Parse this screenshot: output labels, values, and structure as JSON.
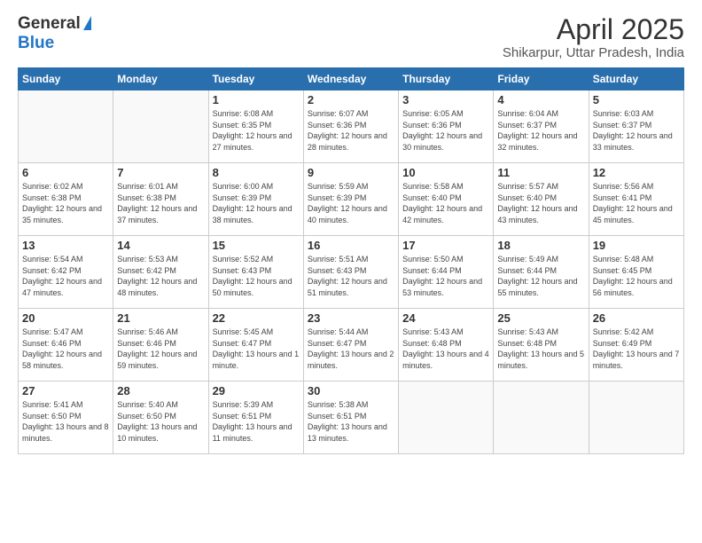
{
  "logo": {
    "line1": "General",
    "line2": "Blue"
  },
  "title": "April 2025",
  "subtitle": "Shikarpur, Uttar Pradesh, India",
  "days_of_week": [
    "Sunday",
    "Monday",
    "Tuesday",
    "Wednesday",
    "Thursday",
    "Friday",
    "Saturday"
  ],
  "weeks": [
    [
      {
        "day": "",
        "info": ""
      },
      {
        "day": "",
        "info": ""
      },
      {
        "day": "1",
        "info": "Sunrise: 6:08 AM\nSunset: 6:35 PM\nDaylight: 12 hours and 27 minutes."
      },
      {
        "day": "2",
        "info": "Sunrise: 6:07 AM\nSunset: 6:36 PM\nDaylight: 12 hours and 28 minutes."
      },
      {
        "day": "3",
        "info": "Sunrise: 6:05 AM\nSunset: 6:36 PM\nDaylight: 12 hours and 30 minutes."
      },
      {
        "day": "4",
        "info": "Sunrise: 6:04 AM\nSunset: 6:37 PM\nDaylight: 12 hours and 32 minutes."
      },
      {
        "day": "5",
        "info": "Sunrise: 6:03 AM\nSunset: 6:37 PM\nDaylight: 12 hours and 33 minutes."
      }
    ],
    [
      {
        "day": "6",
        "info": "Sunrise: 6:02 AM\nSunset: 6:38 PM\nDaylight: 12 hours and 35 minutes."
      },
      {
        "day": "7",
        "info": "Sunrise: 6:01 AM\nSunset: 6:38 PM\nDaylight: 12 hours and 37 minutes."
      },
      {
        "day": "8",
        "info": "Sunrise: 6:00 AM\nSunset: 6:39 PM\nDaylight: 12 hours and 38 minutes."
      },
      {
        "day": "9",
        "info": "Sunrise: 5:59 AM\nSunset: 6:39 PM\nDaylight: 12 hours and 40 minutes."
      },
      {
        "day": "10",
        "info": "Sunrise: 5:58 AM\nSunset: 6:40 PM\nDaylight: 12 hours and 42 minutes."
      },
      {
        "day": "11",
        "info": "Sunrise: 5:57 AM\nSunset: 6:40 PM\nDaylight: 12 hours and 43 minutes."
      },
      {
        "day": "12",
        "info": "Sunrise: 5:56 AM\nSunset: 6:41 PM\nDaylight: 12 hours and 45 minutes."
      }
    ],
    [
      {
        "day": "13",
        "info": "Sunrise: 5:54 AM\nSunset: 6:42 PM\nDaylight: 12 hours and 47 minutes."
      },
      {
        "day": "14",
        "info": "Sunrise: 5:53 AM\nSunset: 6:42 PM\nDaylight: 12 hours and 48 minutes."
      },
      {
        "day": "15",
        "info": "Sunrise: 5:52 AM\nSunset: 6:43 PM\nDaylight: 12 hours and 50 minutes."
      },
      {
        "day": "16",
        "info": "Sunrise: 5:51 AM\nSunset: 6:43 PM\nDaylight: 12 hours and 51 minutes."
      },
      {
        "day": "17",
        "info": "Sunrise: 5:50 AM\nSunset: 6:44 PM\nDaylight: 12 hours and 53 minutes."
      },
      {
        "day": "18",
        "info": "Sunrise: 5:49 AM\nSunset: 6:44 PM\nDaylight: 12 hours and 55 minutes."
      },
      {
        "day": "19",
        "info": "Sunrise: 5:48 AM\nSunset: 6:45 PM\nDaylight: 12 hours and 56 minutes."
      }
    ],
    [
      {
        "day": "20",
        "info": "Sunrise: 5:47 AM\nSunset: 6:46 PM\nDaylight: 12 hours and 58 minutes."
      },
      {
        "day": "21",
        "info": "Sunrise: 5:46 AM\nSunset: 6:46 PM\nDaylight: 12 hours and 59 minutes."
      },
      {
        "day": "22",
        "info": "Sunrise: 5:45 AM\nSunset: 6:47 PM\nDaylight: 13 hours and 1 minute."
      },
      {
        "day": "23",
        "info": "Sunrise: 5:44 AM\nSunset: 6:47 PM\nDaylight: 13 hours and 2 minutes."
      },
      {
        "day": "24",
        "info": "Sunrise: 5:43 AM\nSunset: 6:48 PM\nDaylight: 13 hours and 4 minutes."
      },
      {
        "day": "25",
        "info": "Sunrise: 5:43 AM\nSunset: 6:48 PM\nDaylight: 13 hours and 5 minutes."
      },
      {
        "day": "26",
        "info": "Sunrise: 5:42 AM\nSunset: 6:49 PM\nDaylight: 13 hours and 7 minutes."
      }
    ],
    [
      {
        "day": "27",
        "info": "Sunrise: 5:41 AM\nSunset: 6:50 PM\nDaylight: 13 hours and 8 minutes."
      },
      {
        "day": "28",
        "info": "Sunrise: 5:40 AM\nSunset: 6:50 PM\nDaylight: 13 hours and 10 minutes."
      },
      {
        "day": "29",
        "info": "Sunrise: 5:39 AM\nSunset: 6:51 PM\nDaylight: 13 hours and 11 minutes."
      },
      {
        "day": "30",
        "info": "Sunrise: 5:38 AM\nSunset: 6:51 PM\nDaylight: 13 hours and 13 minutes."
      },
      {
        "day": "",
        "info": ""
      },
      {
        "day": "",
        "info": ""
      },
      {
        "day": "",
        "info": ""
      }
    ]
  ]
}
